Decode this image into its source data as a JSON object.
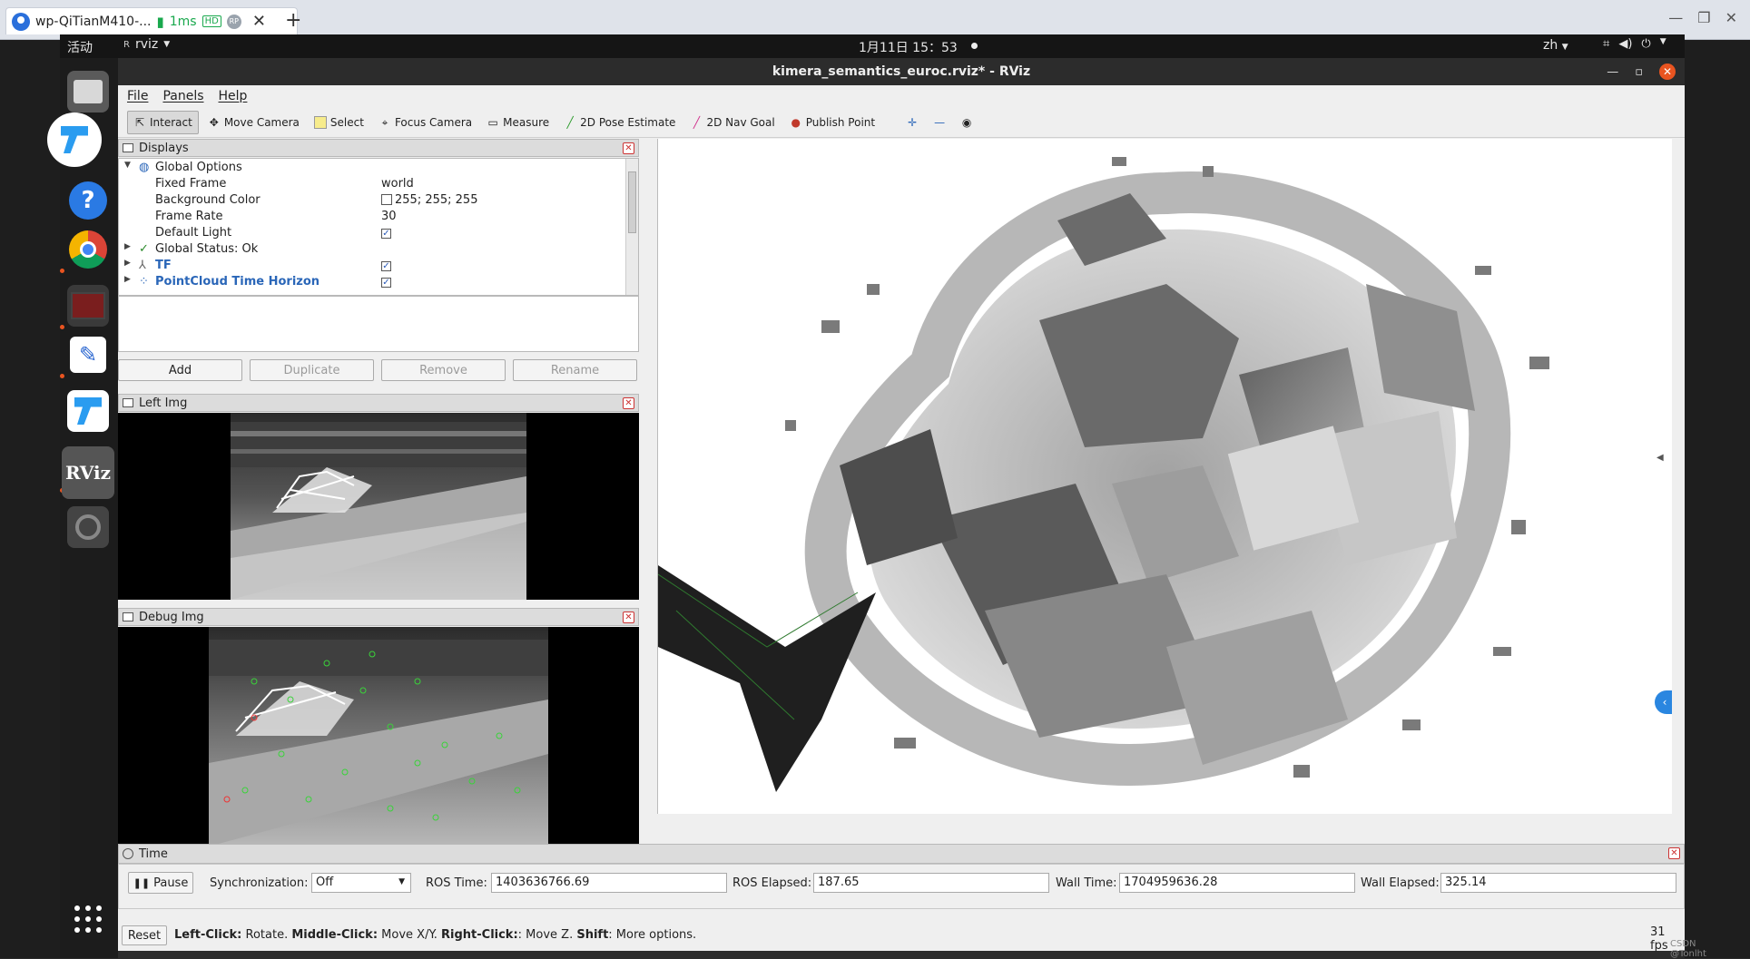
{
  "remote_desktop": {
    "tab_title": "wp-QiTianM410-...",
    "latency": "1ms",
    "hd_badge": "HD",
    "rp_badge": "RP",
    "new_tab": "+"
  },
  "gnome": {
    "activities": "活动",
    "app_name": "rviz",
    "clock": "1月11日  15：53",
    "lang": "zh"
  },
  "window": {
    "title": "kimera_semantics_euroc.rviz* - RViz"
  },
  "menu": [
    "File",
    "Panels",
    "Help"
  ],
  "toolbar": {
    "interact": "Interact",
    "move_camera": "Move Camera",
    "select": "Select",
    "focus_camera": "Focus Camera",
    "measure": "Measure",
    "pose_estimate": "2D Pose Estimate",
    "nav_goal": "2D Nav Goal",
    "publish_point": "Publish Point"
  },
  "displays": {
    "title": "Displays",
    "global_options": "Global Options",
    "fixed_frame_label": "Fixed Frame",
    "fixed_frame_value": "world",
    "bg_color_label": "Background Color",
    "bg_color_value": "255; 255; 255",
    "frame_rate_label": "Frame Rate",
    "frame_rate_value": "30",
    "default_light_label": "Default Light",
    "global_status": "Global Status: Ok",
    "tf": "TF",
    "pointcloud": "PointCloud Time Horizon",
    "buttons": {
      "add": "Add",
      "duplicate": "Duplicate",
      "remove": "Remove",
      "rename": "Rename"
    }
  },
  "left_img": {
    "title": "Left Img"
  },
  "debug_img": {
    "title": "Debug Img"
  },
  "time": {
    "title": "Time",
    "pause": "Pause",
    "sync_label": "Synchronization:",
    "sync_value": "Off",
    "ros_time_label": "ROS Time:",
    "ros_time_value": "1403636766.69",
    "ros_elapsed_label": "ROS Elapsed:",
    "ros_elapsed_value": "187.65",
    "wall_time_label": "Wall Time:",
    "wall_time_value": "1704959636.28",
    "wall_elapsed_label": "Wall Elapsed:",
    "wall_elapsed_value": "325.14"
  },
  "status_bar": {
    "reset": "Reset",
    "left_click": "Left-Click:",
    "left_click_desc": " Rotate. ",
    "middle_click": "Middle-Click:",
    "middle_click_desc": " Move X/Y. ",
    "right_click": "Right-Click:",
    "right_click_desc": ": Move Z. ",
    "shift": "Shift",
    "shift_desc": ": More options.",
    "fps": "31 fps",
    "watermark": "CSDN @Tonlht"
  }
}
